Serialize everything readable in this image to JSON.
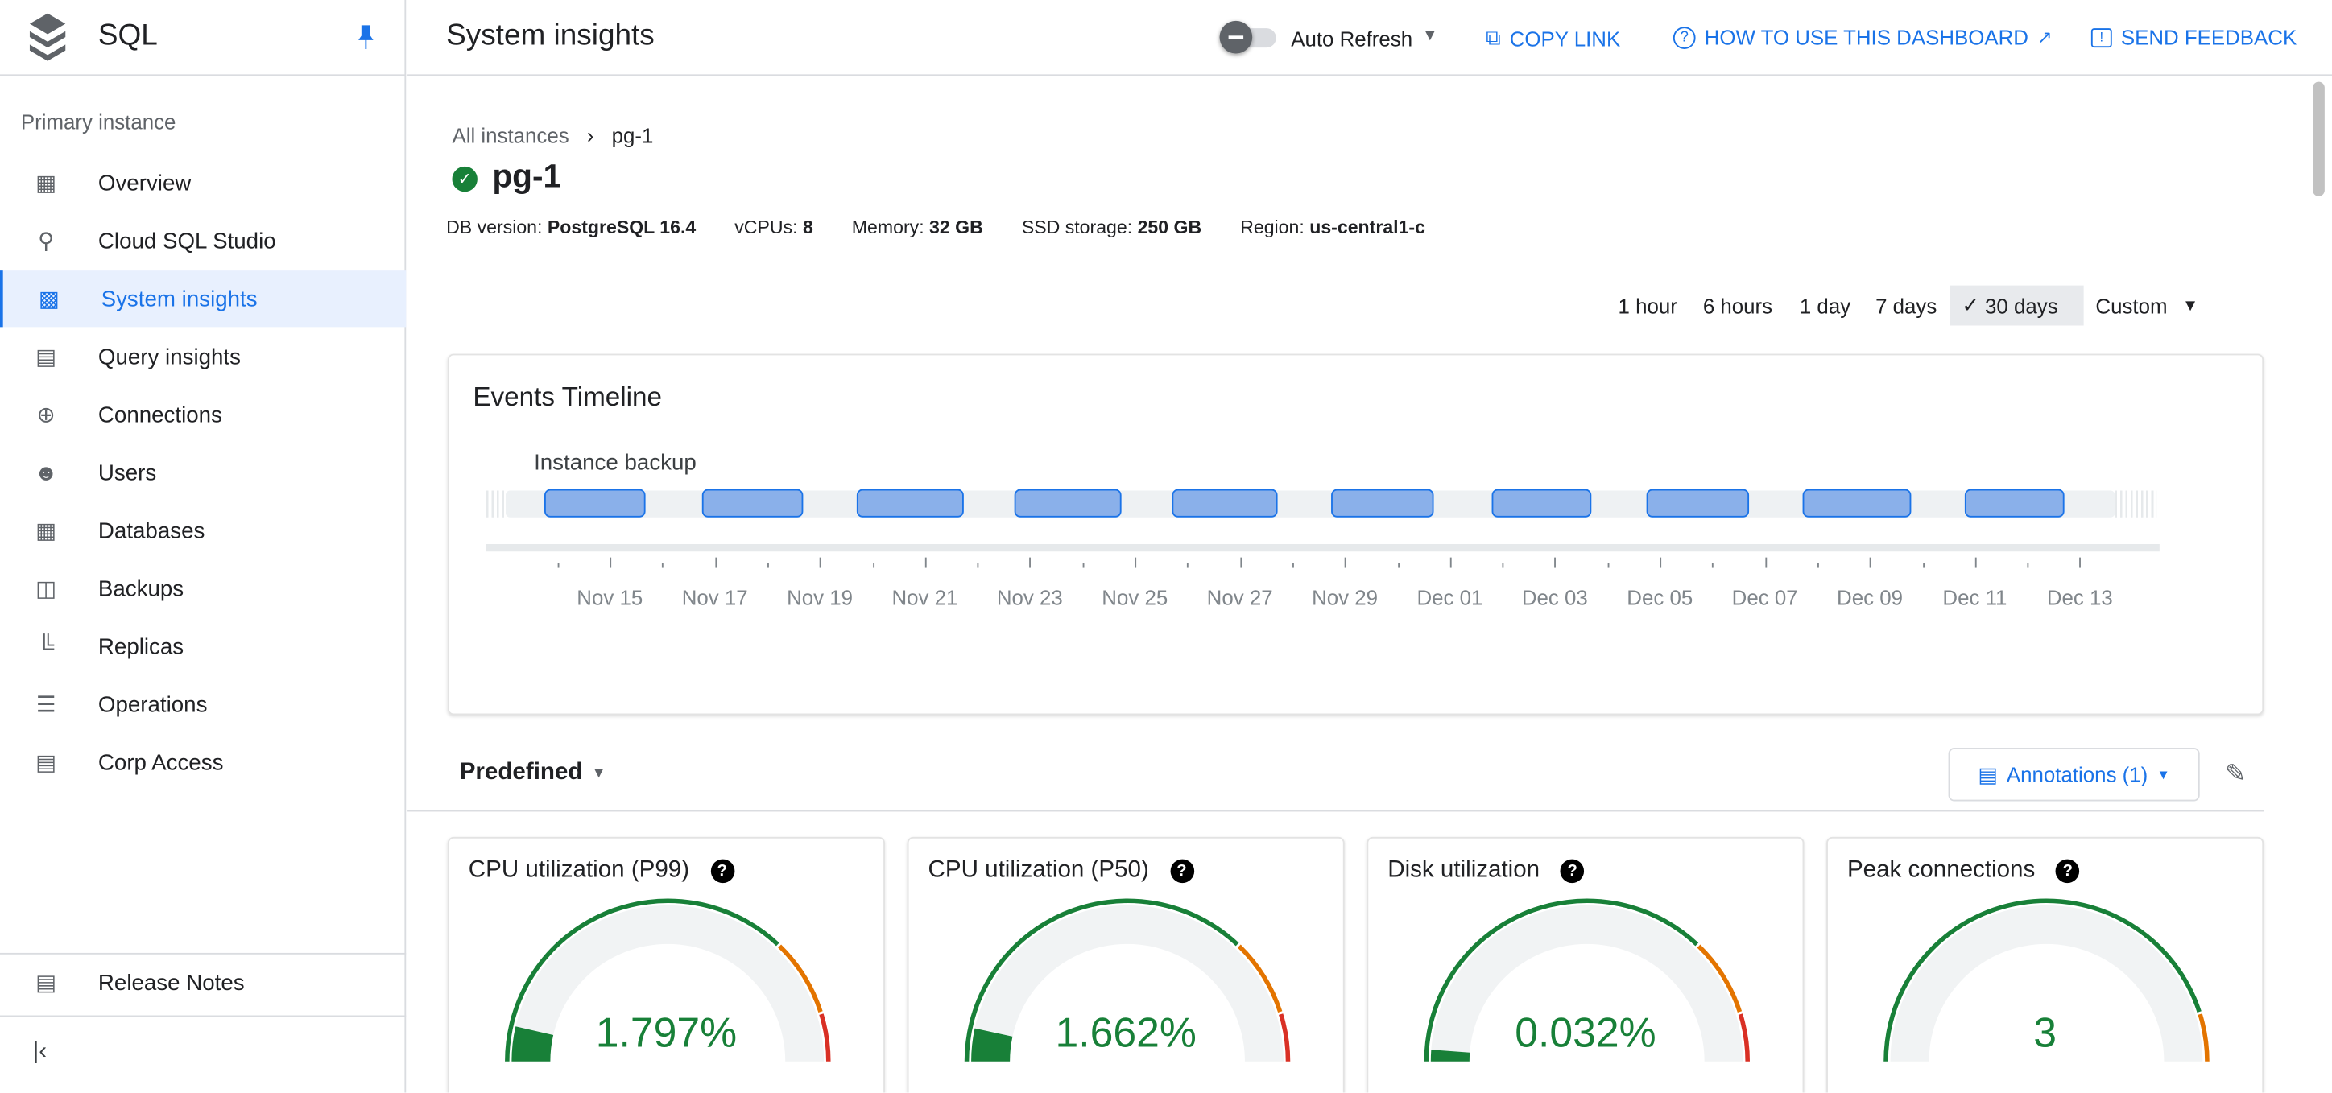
{
  "app": {
    "title": "SQL",
    "pin_icon": "pin-icon",
    "logo_icon": "sql-logo-icon"
  },
  "sidebar": {
    "section": "Primary instance",
    "items": [
      {
        "label": "Overview",
        "icon": "overview-icon"
      },
      {
        "label": "Cloud SQL Studio",
        "icon": "search-icon"
      },
      {
        "label": "System insights",
        "icon": "monitor-icon",
        "active": true
      },
      {
        "label": "Query insights",
        "icon": "chart-icon"
      },
      {
        "label": "Connections",
        "icon": "connections-icon"
      },
      {
        "label": "Users",
        "icon": "users-icon"
      },
      {
        "label": "Databases",
        "icon": "databases-icon"
      },
      {
        "label": "Backups",
        "icon": "backups-icon"
      },
      {
        "label": "Replicas",
        "icon": "replicas-icon"
      },
      {
        "label": "Operations",
        "icon": "list-icon"
      },
      {
        "label": "Corp Access",
        "icon": "corp-access-icon"
      }
    ],
    "release_notes": "Release Notes",
    "collapse": "collapse-icon"
  },
  "header": {
    "title": "System insights",
    "auto_refresh": "Auto Refresh",
    "copy_link": "COPY LINK",
    "how_to": "HOW TO USE THIS DASHBOARD",
    "feedback": "SEND FEEDBACK"
  },
  "breadcrumb": {
    "root": "All instances",
    "current": "pg-1"
  },
  "instance": {
    "name": "pg-1",
    "status": "running",
    "specs": [
      {
        "label": "DB version:",
        "value": "PostgreSQL 16.4"
      },
      {
        "label": "vCPUs:",
        "value": "8"
      },
      {
        "label": "Memory:",
        "value": "32 GB"
      },
      {
        "label": "SSD storage:",
        "value": "250 GB"
      },
      {
        "label": "Region:",
        "value": "us-central1-c"
      }
    ]
  },
  "time_ranges": [
    "1 hour",
    "6 hours",
    "1 day",
    "7 days",
    "30 days",
    "Custom"
  ],
  "selected_range": "30 days",
  "timeline": {
    "title": "Events Timeline",
    "row_label": "Instance backup",
    "ticks": [
      "Nov 15",
      "Nov 17",
      "Nov 19",
      "Nov 21",
      "Nov 23",
      "Nov 25",
      "Nov 27",
      "Nov 29",
      "Dec 01",
      "Dec 03",
      "Dec 05",
      "Dec 07",
      "Dec 09",
      "Dec 11",
      "Dec 13"
    ],
    "event_count": 10,
    "event_color": "#8ab0ea"
  },
  "dashboard": {
    "selector": "Predefined",
    "annotations": "Annotations (1)"
  },
  "gauges": [
    {
      "title": "CPU utilization (P99)",
      "value": "1.797%",
      "fraction": 0.018,
      "thresholds": [
        0.74,
        0.9
      ]
    },
    {
      "title": "CPU utilization (P50)",
      "value": "1.662%",
      "fraction": 0.017,
      "thresholds": [
        0.74,
        0.9
      ]
    },
    {
      "title": "Disk utilization",
      "value": "0.032%",
      "fraction": 0.0003,
      "thresholds": [
        0.74,
        0.9
      ]
    },
    {
      "title": "Peak connections",
      "value": "3",
      "fraction": 0.0,
      "thresholds": [
        0.9,
        1.0
      ]
    }
  ],
  "colors": {
    "accent": "#1a73e8",
    "ok": "#188038",
    "warn": "#e37400",
    "crit": "#d93025"
  }
}
